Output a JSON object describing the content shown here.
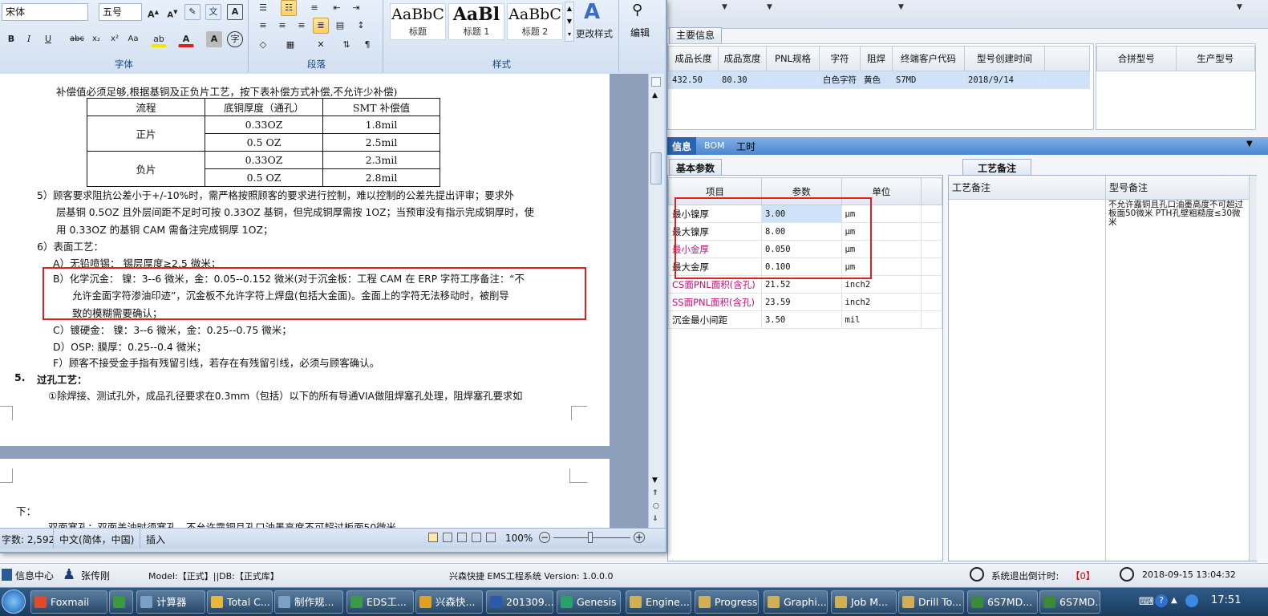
{
  "erp": {
    "top_tab": "主要信息",
    "main_grid": {
      "headers": [
        "成品长度",
        "成品宽度",
        "PNL规格",
        "字符",
        "阻焊",
        "终端客户代码",
        "型号创建时间"
      ],
      "row": [
        "432.50",
        "80.30",
        "",
        "白色字符",
        "黄色",
        "S7MD",
        "2018/9/14"
      ]
    },
    "side_grid_headers": [
      "合拼型号",
      "生产型号"
    ],
    "detail_tabs": [
      "信息",
      "BOM",
      "工时"
    ],
    "basic_params_tab": "基本参数",
    "param_headers": [
      "项目",
      "参数",
      "单位"
    ],
    "params": [
      {
        "item": "最小镍厚",
        "value": "3.00",
        "unit": "μm"
      },
      {
        "item": "最大镍厚",
        "value": "8.00",
        "unit": "μm"
      },
      {
        "item": "最小金厚",
        "value": "0.050",
        "unit": "μm"
      },
      {
        "item": "最大金厚",
        "value": "0.100",
        "unit": "μm"
      },
      {
        "item": "CS面PNL面积(含孔)",
        "value": "21.52",
        "unit": "inch2"
      },
      {
        "item": "SS面PNL面积(含孔)",
        "value": "23.59",
        "unit": "inch2"
      },
      {
        "item": "沉金最小间距",
        "value": "3.50",
        "unit": "mil"
      }
    ],
    "process_tab": "工艺备注",
    "process_headers": [
      "工艺备注",
      "型号备注"
    ],
    "model_note": "不允许露铜且孔口油墨高度不可超过板面50微米     PTH孔壁粗糙度≤30微米",
    "bottom": {
      "info_center": "信息中心",
      "user": "张传刚",
      "model_db": "Model:【正式】||DB:【正式库】",
      "system": "兴森快捷 EMS工程系统 Version: 1.0.0.0",
      "countdown_label": "系统退出倒计时:",
      "countdown_value": "【0】",
      "datetime": "2018-09-15 13:04:32"
    }
  },
  "word": {
    "ribbon": {
      "font_name": "宋体",
      "font_size": "五号",
      "font_group": "字体",
      "para_group": "段落",
      "styles_group": "样式",
      "styles": [
        {
          "sample": "AaBbC",
          "caption": "标题"
        },
        {
          "sample": "AaBl",
          "caption": "标题 1"
        },
        {
          "sample": "AaBbC",
          "caption": "标题 2"
        }
      ],
      "change_styles": "更改样式",
      "edit": "编辑"
    },
    "doc": {
      "line0": "补偿值必须足够,根据基铜及正负片工艺，按下表补偿方式补偿,不允许少补偿)",
      "table_headers": [
        "流程",
        "底铜厚度（通孔）",
        "SMT 补偿值"
      ],
      "table_rows": [
        {
          "group": "正片",
          "thick": "0.33OZ",
          "comp": "1.8mil"
        },
        {
          "group": "",
          "thick": "0.5 OZ",
          "comp": "2.5mil"
        },
        {
          "group": "负片",
          "thick": "0.33OZ",
          "comp": "2.3mil"
        },
        {
          "group": "",
          "thick": "0.5 OZ",
          "comp": "2.8mil"
        }
      ],
      "p5a": "5）顾客要求阻抗公差小于+/-10%时，需严格按照顾客的要求进行控制，难以控制的公差先提出评审；要求外",
      "p5b": "层基铜 0.5OZ 且外层间距不足时可按 0.33OZ 基铜，但完成铜厚需按 1OZ；当预审没有指示完成铜厚时，使",
      "p5c": "用 0.33OZ 的基铜 CAM 需备注完成铜厚 1OZ；",
      "p6": "6）表面工艺：",
      "pA": "A）无铅喷锡：  锡层厚度≥2.5 微米；",
      "pB1": "B）化学沉金：  镍：3--6 微米，金：0.05--0.152 微米(对于沉金板：工程 CAM 在 ERP 字符工序备注：“不",
      "pB2": "允许金面字符渗油印迹”，沉金板不允许字符上焊盘(包括大金面)。金面上的字符无法移动时，被削导",
      "pB3": "致的模糊需要确认；",
      "pC": "C）镀硬金：    镍：3--6 微米，金：0.25--0.75 微米；",
      "pD": "D）OSP:         膜厚：0.25--0.4 微米；",
      "pF": "F）顾客不接受金手指有残留引线，若存在有残留引线，必须与顾客确认。",
      "h5num": "5.",
      "h5": "过孔工艺：",
      "p_via": "①除焊接、测试孔外，成品孔径要求在0.3mm（包括）以下的所有导通VIA做阻焊塞孔处理，阻焊塞孔要求如",
      "p_next": "下：",
      "p_next2": "双面塞孔：双面盖油时须塞孔，不允许露铜且孔口油墨高度不可超过板面50微米"
    },
    "status": {
      "words": "字数: 2,592",
      "lang": "中文(简体，中国)",
      "mode": "插入",
      "zoom": "100%"
    }
  },
  "taskbar": {
    "items": [
      {
        "label": "Foxmail",
        "color": "#e04a2a"
      },
      {
        "label": "",
        "color": "#3b9a3b"
      },
      {
        "label": "计算器",
        "color": "#7aa0c8"
      },
      {
        "label": "Total C...",
        "color": "#e6b93a"
      },
      {
        "label": "制作规...",
        "color": "#7aa0c8"
      },
      {
        "label": "EDS工...",
        "color": "#3a9a48"
      },
      {
        "label": "兴森快...",
        "color": "#e0a020"
      },
      {
        "label": "201309...",
        "color": "#2a5aa8"
      },
      {
        "label": "Genesis",
        "color": "#2aa06a"
      },
      {
        "label": "Engine...",
        "color": "#d0b050"
      },
      {
        "label": "Progress",
        "color": "#d0b050"
      },
      {
        "label": "Graphi...",
        "color": "#d0b050"
      },
      {
        "label": "Job M...",
        "color": "#d0b050"
      },
      {
        "label": "Drill To...",
        "color": "#d0b050"
      },
      {
        "label": "6S7MD...",
        "color": "#3a8a3a"
      },
      {
        "label": "6S7MD...",
        "color": "#3a8a3a"
      }
    ],
    "clock": "17:51"
  }
}
